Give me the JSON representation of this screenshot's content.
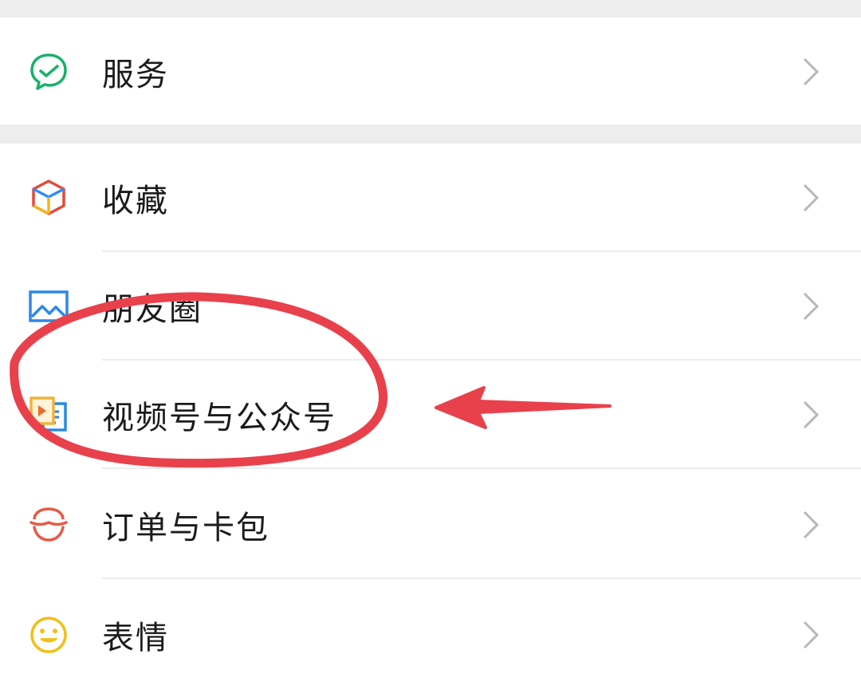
{
  "menu": {
    "services": {
      "label": "服务",
      "icon": "chat-check-icon"
    },
    "favorites": {
      "label": "收藏",
      "icon": "cube-icon"
    },
    "moments": {
      "label": "朋友圈",
      "icon": "picture-icon"
    },
    "channels": {
      "label": "视频号与公众号",
      "icon": "video-article-icon"
    },
    "orders": {
      "label": "订单与卡包",
      "icon": "basket-icon"
    },
    "stickers": {
      "label": "表情",
      "icon": "smiley-icon"
    }
  },
  "colors": {
    "background": "#ededed",
    "row_background": "#ffffff",
    "text": "#1b1b1b",
    "chevron": "#b8b8b8",
    "annotation": "#e8414c",
    "wechat_green": "#07c160"
  }
}
